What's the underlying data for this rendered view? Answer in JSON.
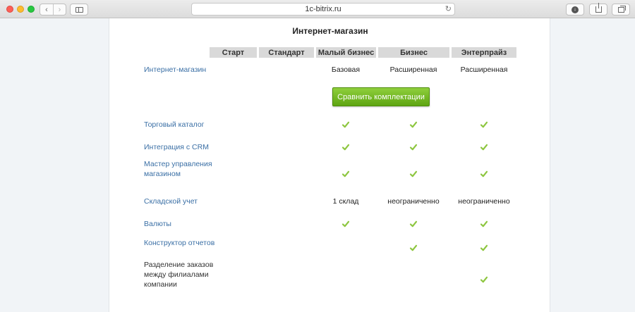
{
  "browser": {
    "url": "1c-bitrix.ru",
    "back_glyph": "‹",
    "forward_glyph": "›",
    "reload_glyph": "↻",
    "download_glyph": "↓",
    "accent_colors": {
      "close": "#fc5f57",
      "minimize": "#fdbc2e",
      "zoom": "#28c840"
    },
    "icons": [
      "back-icon",
      "forward-icon",
      "sidebar-icon",
      "reload-icon",
      "download-icon",
      "share-icon",
      "tabs-icon"
    ]
  },
  "page": {
    "title": "Интернет-магазин",
    "columns": [
      "Старт",
      "Стандарт",
      "Малый бизнес",
      "Бизнес",
      "Энтерпрайз"
    ],
    "compare_button": "Сравнить комплектации",
    "check_color": "#8dc63f",
    "link_color": "#3a6fa5",
    "rows": [
      {
        "label": "Интернет-магазин",
        "values": [
          "",
          "",
          "Базовая",
          "Расширенная",
          "Расширенная"
        ]
      },
      {
        "label": "Торговый каталог",
        "values": [
          "",
          "",
          "check",
          "check",
          "check"
        ]
      },
      {
        "label": "Интеграция с CRM",
        "values": [
          "",
          "",
          "check",
          "check",
          "check"
        ]
      },
      {
        "label": "Мастер управления магазином",
        "values": [
          "",
          "",
          "check",
          "check",
          "check"
        ]
      },
      {
        "label": "Складской учет",
        "values": [
          "",
          "",
          "1 склад",
          "неограниченно",
          "неограниченно"
        ]
      },
      {
        "label": "Валюты",
        "values": [
          "",
          "",
          "check",
          "check",
          "check"
        ]
      },
      {
        "label": "Конструктор отчетов",
        "values": [
          "",
          "",
          "",
          "check",
          "check"
        ]
      },
      {
        "label": "Разделение заказов между филиалами компании",
        "values": [
          "",
          "",
          "",
          "",
          "check"
        ]
      }
    ]
  }
}
